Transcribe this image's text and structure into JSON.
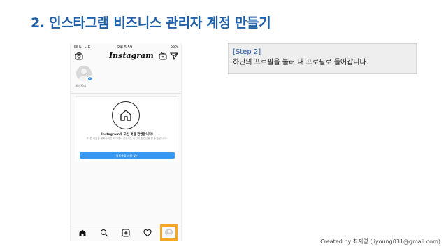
{
  "slide": {
    "title": "2. 인스타그램 비즈니스 관리자 계정 만들기",
    "credit": "Created by 최지영 (jiyoung031@gmail.com)"
  },
  "phone": {
    "status": {
      "carrier": "ııll KT  LTE",
      "time": "오후 5:59",
      "battery": "65%"
    },
    "app_name": "Instagram",
    "story_label": "내 스토리",
    "welcome": {
      "title": "Instagram에 오신 것을 환영합니다!",
      "description": "다른 사람을 팔로우하면 피드에서 공유하는 사진과 동영상을 볼 수 있습니다.",
      "button": "팔로우할 사람 찾기"
    },
    "bottom_nav": [
      "home-icon",
      "search-icon",
      "add-post-icon",
      "heart-icon",
      "profile-tab"
    ],
    "highlight_color": "#f5a623",
    "accent_color": "#3897f0"
  },
  "step": {
    "label": "[Step 2]",
    "text": "하단의 프로필을 눌러 내 프로필로 들어갑니다."
  },
  "colors": {
    "title": "#1f5fa8",
    "callout_bg": "#eeeeee"
  }
}
